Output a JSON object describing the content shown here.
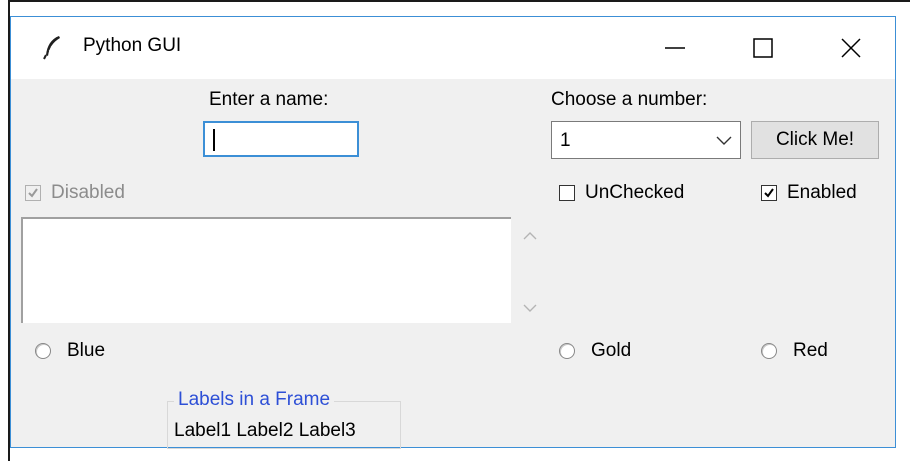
{
  "window": {
    "title": "Python GUI",
    "app_icon": "feather-icon",
    "controls": [
      "minimize-icon",
      "maximize-icon",
      "close-icon"
    ]
  },
  "form": {
    "name_label": "Enter a name:",
    "name_value": "",
    "number_label": "Choose a number:",
    "number_selected": "1",
    "click_button": "Click Me!"
  },
  "checkboxes": [
    {
      "label": "Disabled",
      "checked": true,
      "enabled": false
    },
    {
      "label": "UnChecked",
      "checked": false,
      "enabled": true
    },
    {
      "label": "Enabled",
      "checked": true,
      "enabled": true
    }
  ],
  "scrolled_text": {
    "value": ""
  },
  "radios": [
    {
      "label": "Blue",
      "selected": false
    },
    {
      "label": "Gold",
      "selected": false
    },
    {
      "label": "Red",
      "selected": false
    }
  ],
  "label_frame": {
    "title": "Labels in a Frame",
    "labels": [
      "Label1",
      "Label2",
      "Label3"
    ]
  },
  "colors": {
    "window_border": "#3c8fd6",
    "frame_title": "#2d4fd6",
    "background": "#f0f0f0"
  }
}
